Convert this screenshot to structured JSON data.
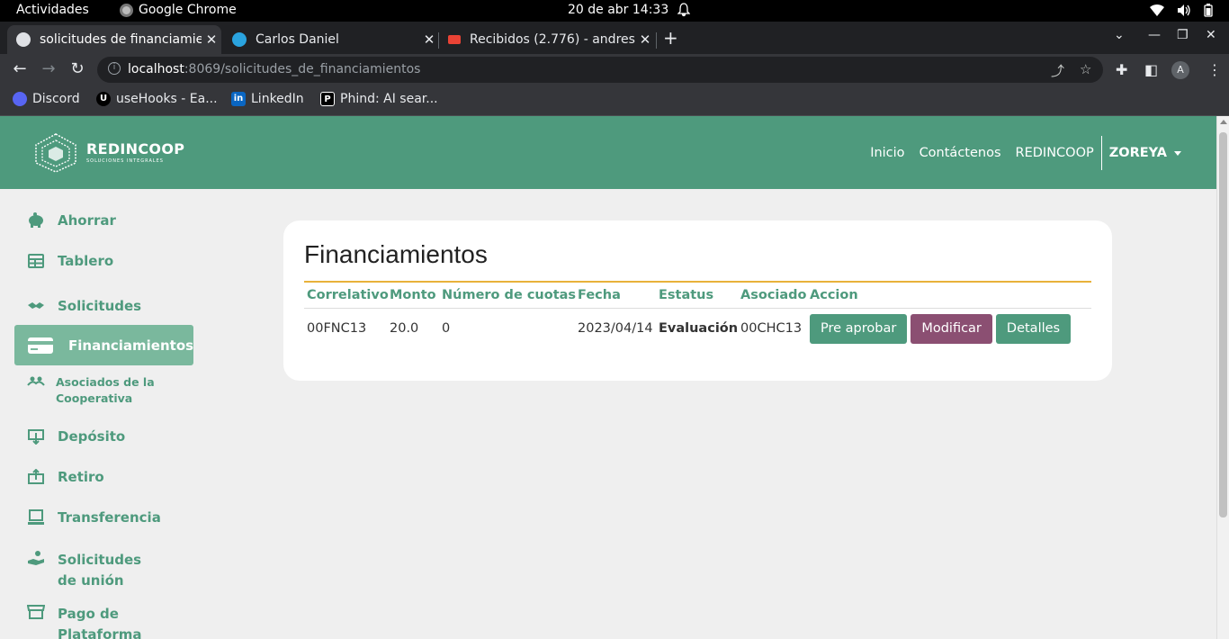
{
  "os": {
    "activities": "Actividades",
    "app_name": "Google Chrome",
    "datetime": "20 de abr  14:33"
  },
  "browser": {
    "tabs": [
      {
        "title": "solicitudes de financiamie",
        "active": true
      },
      {
        "title": "Carlos Daniel",
        "active": false
      },
      {
        "title": "Recibidos (2.776) - andres",
        "active": false
      }
    ],
    "url_host": "localhost",
    "url_rest": ":8069/solicitudes_de_financiamientos",
    "profile_initial": "A",
    "bookmarks": [
      "Discord",
      "useHooks - Ea...",
      "LinkedIn",
      "Phind: AI sear..."
    ]
  },
  "site": {
    "brand": "REDINCOOP",
    "brand_sub": "SOLUCIONES INTEGRALES",
    "nav": [
      "Inicio",
      "Contáctenos",
      "REDINCOOP"
    ],
    "user": "ZOREYA"
  },
  "sidebar": {
    "items": [
      {
        "label": "Ahorrar",
        "icon": "piggy-bank-icon"
      },
      {
        "label": "Tablero",
        "icon": "table-icon"
      },
      {
        "label": "Solicitudes",
        "icon": "handshake-icon"
      },
      {
        "label": "Financiamientos",
        "icon": "credit-card-icon",
        "active": true
      },
      {
        "label": "Asociados de la Cooperativa",
        "icon": "people-icon"
      },
      {
        "label": "Depósito",
        "icon": "deposit-icon"
      },
      {
        "label": "Retiro",
        "icon": "withdraw-icon"
      },
      {
        "label": "Transferencia",
        "icon": "transfer-icon"
      },
      {
        "label": "Solicitudes de unión",
        "icon": "hand-plus-icon"
      },
      {
        "label": "Pago de Plataforma",
        "icon": "store-icon"
      }
    ]
  },
  "main": {
    "title": "Financiamientos",
    "columns": [
      "Correlativo",
      "Monto",
      "Número de cuotas",
      "Fecha",
      "Estatus",
      "Asociado",
      "Accion"
    ],
    "rows": [
      {
        "correlativo": "00FNC13",
        "monto": "20.0",
        "cuotas": "0",
        "fecha": "2023/04/14",
        "estatus": "Evaluación",
        "asociado": "00CHC13"
      }
    ],
    "actions": {
      "preaprobar": "Pre aprobar",
      "modificar": "Modificar",
      "detalles": "Detalles"
    }
  },
  "colors": {
    "primary": "#4e9a7d",
    "accent": "#e8b23a",
    "modify": "#8b4f72"
  }
}
